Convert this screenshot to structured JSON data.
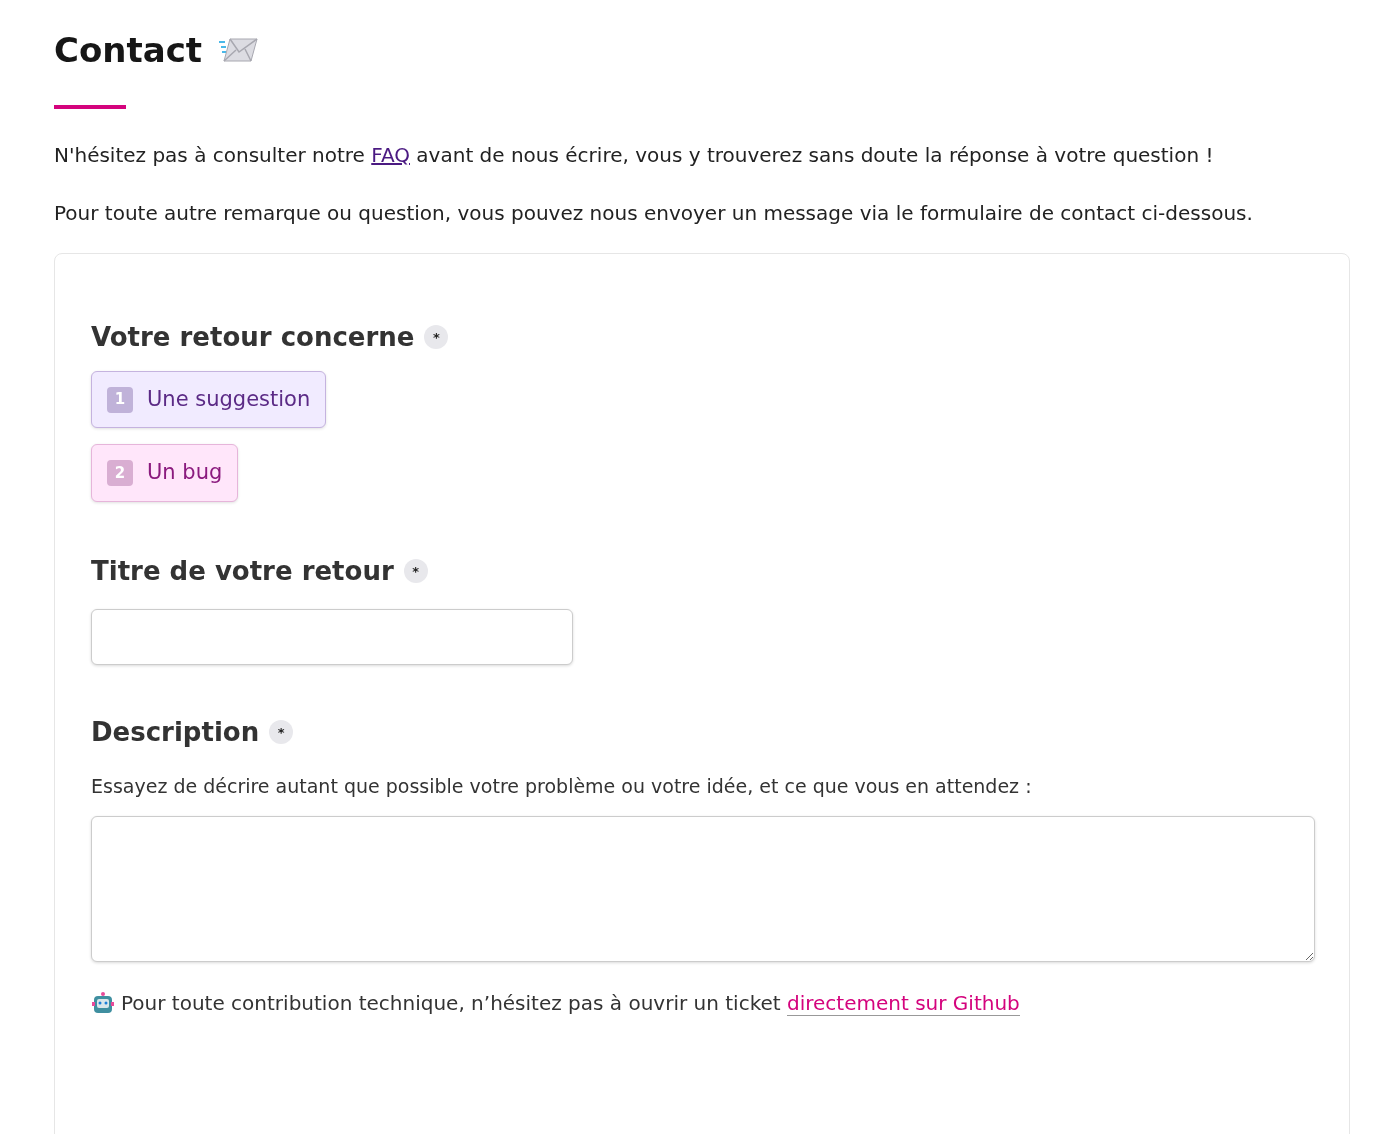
{
  "page": {
    "title": "Contact"
  },
  "intro": {
    "before": "N'hésitez pas à consulter notre ",
    "link": "FAQ",
    "after": " avant de nous écrire, vous y trouverez sans doute la réponse à votre question !"
  },
  "intro2": "Pour toute autre remarque ou question, vous pouvez nous envoyer un message via le formulaire de contact ci-dessous.",
  "form": {
    "topic": {
      "label": "Votre retour concerne",
      "required_mark": "*",
      "choices": [
        {
          "key": "1",
          "label": "Une suggestion",
          "selected": false,
          "color": "#5b2a86"
        },
        {
          "key": "2",
          "label": "Un bug",
          "selected": false,
          "color": "#8b1a7e"
        }
      ]
    },
    "title_field": {
      "label": "Titre de votre retour",
      "required_mark": "*"
    },
    "description": {
      "label": "Description",
      "required_mark": "*",
      "help": "Essayez de décrire autant que possible votre problème ou votre idée, et ce que vous en attendez :"
    },
    "footer": {
      "text": "Pour toute contribution technique, n’hésitez pas à ouvrir un ticket ",
      "link": "directement sur Github"
    }
  }
}
